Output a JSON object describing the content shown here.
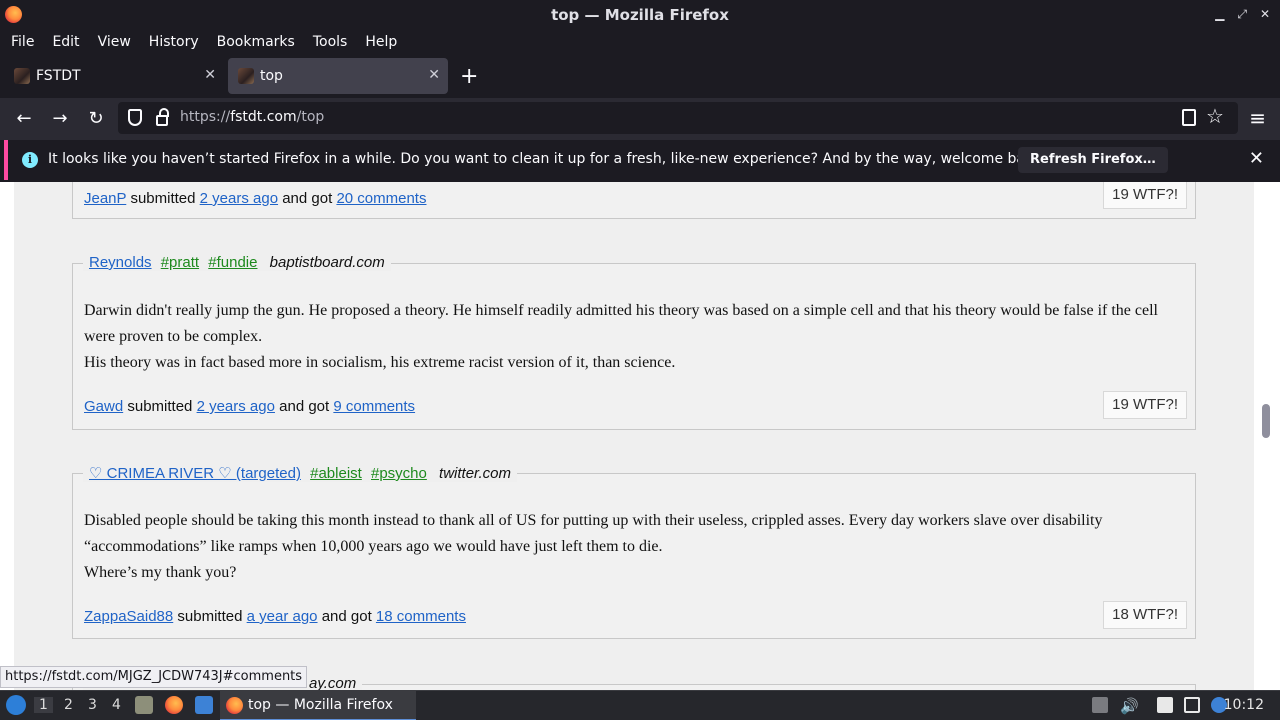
{
  "window": {
    "title": "top — Mozilla Firefox"
  },
  "menu": [
    "File",
    "Edit",
    "View",
    "History",
    "Bookmarks",
    "Tools",
    "Help"
  ],
  "tabs": [
    {
      "label": "FSTDT",
      "active": false
    },
    {
      "label": "top",
      "active": true
    }
  ],
  "address": {
    "scheme": "https://",
    "host": "fstdt.com",
    "path": "/top"
  },
  "notification": {
    "message": "It looks like you haven’t started Firefox in a while. Do you want to clean it up for a fresh, like-new experience? And by the way, welcome back!",
    "button": "Refresh Firefox…"
  },
  "quotes": [
    {
      "submitter": "JeanP",
      "age": "2 years ago",
      "comments": "20 comments",
      "wtf": "19 WTF?!"
    },
    {
      "author": "Reynolds",
      "tags": [
        "#pratt",
        "#fundie"
      ],
      "source": "baptistboard.com",
      "body": [
        "Darwin didn't really jump the gun. He proposed a theory. He himself readily admitted his theory was based on a simple cell and that his theory would be false if the cell were proven to be complex.",
        "His theory was in fact based more in socialism, his extreme racist version of it, than science."
      ],
      "submitter": "Gawd",
      "age": "2 years ago",
      "comments": "9 comments",
      "wtf": "19 WTF?!"
    },
    {
      "author": "♡ CRIMEA RIVER ♡ (targeted)",
      "tags": [
        "#ableist",
        "#psycho"
      ],
      "source": "twitter.com",
      "body": [
        "Disabled people should be taking this month instead to thank all of US for putting up with their useless, crippled asses. Every day workers slave over disability “accommodations” like ramps when 10,000 years ago we would have just left them to die.",
        "Where’s my thank you?"
      ],
      "submitter": "ZappaSaid88",
      "age": "a year ago",
      "comments": "18 comments",
      "wtf": "18 WTF?!"
    }
  ],
  "next_source_fragment": "ay.com",
  "meta_words": {
    "submitted": "submitted",
    "and_got": "and got"
  },
  "status_url": "https://fstdt.com/MJGZ_JCDW743J#comments",
  "taskbar": {
    "workspaces": [
      "1",
      "2",
      "3",
      "4"
    ],
    "task_label": "top — Mozilla Firefox",
    "clock": "10:12"
  },
  "colors": {
    "link": "#1f63c7",
    "tag": "#1e8a1e",
    "notification_accent": "#ff4aa2"
  }
}
